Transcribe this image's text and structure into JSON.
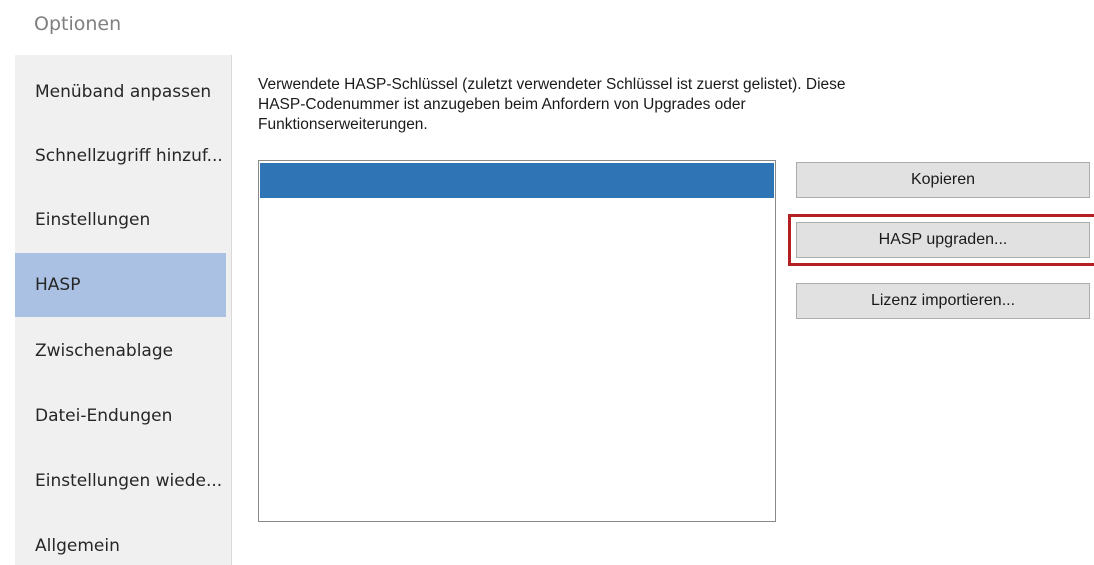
{
  "window": {
    "title": "Optionen"
  },
  "sidebar": {
    "items": [
      {
        "label": "Menüband anpassen"
      },
      {
        "label": "Schnellzugriff hinzuf..."
      },
      {
        "label": "Einstellungen"
      },
      {
        "label": "HASP",
        "selected": true
      },
      {
        "label": "Zwischenablage"
      },
      {
        "label": "Datei-Endungen"
      },
      {
        "label": "Einstellungen wiede..."
      },
      {
        "label": "Allgemein"
      }
    ]
  },
  "main": {
    "description_line1": "Verwendete HASP-Schlüssel (zuletzt verwendeter Schlüssel ist zuerst gelistet). Diese",
    "description_line2": "HASP-Codenummer ist anzugeben beim Anfordern von Upgrades oder",
    "description_line3": "Funktionserweiterungen.",
    "keys_list": {
      "items": [
        ""
      ]
    },
    "buttons": {
      "copy_label": "Kopieren",
      "upgrade_label": "HASP upgraden...",
      "import_label": "Lizenz importieren..."
    }
  },
  "colors": {
    "selected_sidebar": "#abc1e3",
    "list_selection": "#2f75b6",
    "highlight_frame": "#b41f24",
    "title_text": "#7f7f7f"
  }
}
